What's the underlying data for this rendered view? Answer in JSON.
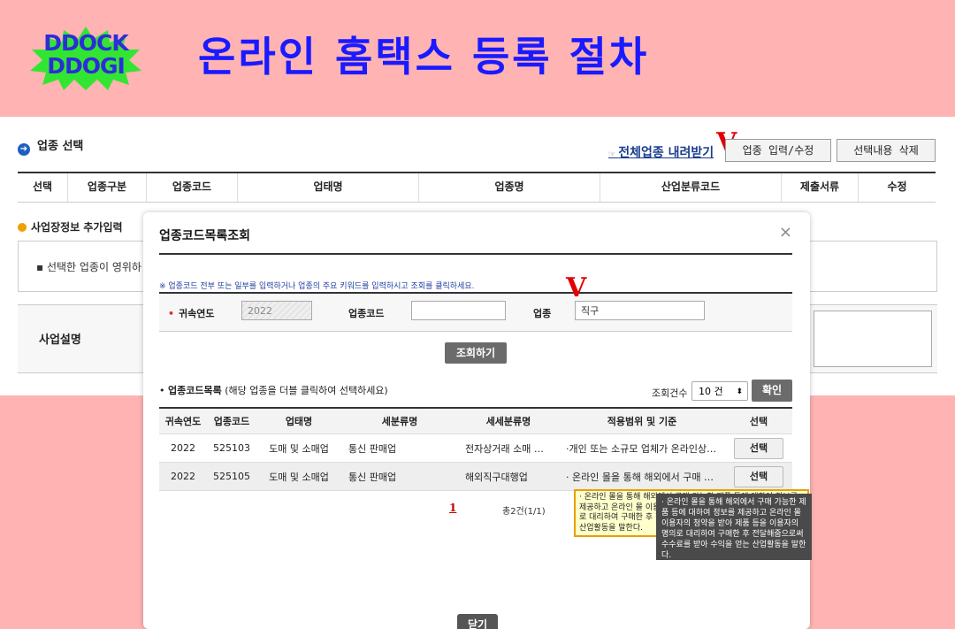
{
  "banner": {
    "logo_line1": "DDOCK",
    "logo_line2": "DDOGI",
    "title": "온라인 홈택스 등록 절차",
    "logo_color": "#2d2dd8",
    "burst_color": "#33e533"
  },
  "page": {
    "section_title": "업종 선택",
    "link_all": "전체업종 내려받기",
    "btn_input": "업종 입력/수정",
    "btn_delete": "선택내용 삭제",
    "mark": "V",
    "columns": [
      "선택",
      "업종구분",
      "업종코드",
      "업태명",
      "업종명",
      "산업분류코드",
      "제출서류",
      "수정"
    ],
    "extra_section_title": "사업장정보 추가입력",
    "info_text": "선택한 업종이 영위하",
    "business_desc_label": "사업설명"
  },
  "modal": {
    "title": "업종코드목록조회",
    "close_icon": "×",
    "hint": "※ 업종코드 전부 또는 일부를 입력하거나 업종의 주요 키워드를 입력하시고 조회를 클릭하세요.",
    "year_label": "귀속연도",
    "year_value": "2022",
    "code_label": "업종코드",
    "code_value": "",
    "biz_label": "업종",
    "biz_value": "직구",
    "mark": "V",
    "search_btn": "조회하기",
    "list_title": "업종코드목록",
    "list_hint": "(해당 업종을 더블 클릭하여 선택하세요)",
    "count_label": "조회건수",
    "count_value": "10 건",
    "confirm_btn": "확인",
    "table_headers": [
      "귀속연도",
      "업종코드",
      "업태명",
      "세분류명",
      "세세분류명",
      "적용범위 및 기준",
      "선택"
    ],
    "rows": [
      [
        "2022",
        "525103",
        "도매 및 소매업",
        "통신 판매업",
        "전자상거래 소매 …",
        "·개인 또는 소규모 업체가 온라인상…",
        "선택"
      ],
      [
        "2022",
        "525105",
        "도매 및 소매업",
        "통신 판매업",
        "해외직구대행업",
        "· 온라인 몰을 통해 해외에서 구매 …",
        "선택"
      ]
    ],
    "pager_num": "1",
    "pager_total": "총2건(1/1)",
    "tooltip_yellow": "· 온라인 몰을 통해 해외에서 구매 가능한 제품 등에 대하여 정보를 제공하고 온라인 몰 이용자의 청약을 받아 제품 등을 이용자의 명의로 대리하여 구매한 후 전달해줌으로써 수수료를 받아 수익을 얻는 산업활동을 말한다.",
    "tooltip_dark": "· 온라인 몰을 통해 해외에서 구매 가능한 제품 등에 대하여 정보를 제공하고 온라인 몰 이용자의 청약을 받아 제품 등을 이용자의 명의로 대리하여 구매한 후 전달해줌으로써 수수료를 받아 수익을 얻는 산업활동을 말한다.",
    "close_btn": "닫기"
  }
}
